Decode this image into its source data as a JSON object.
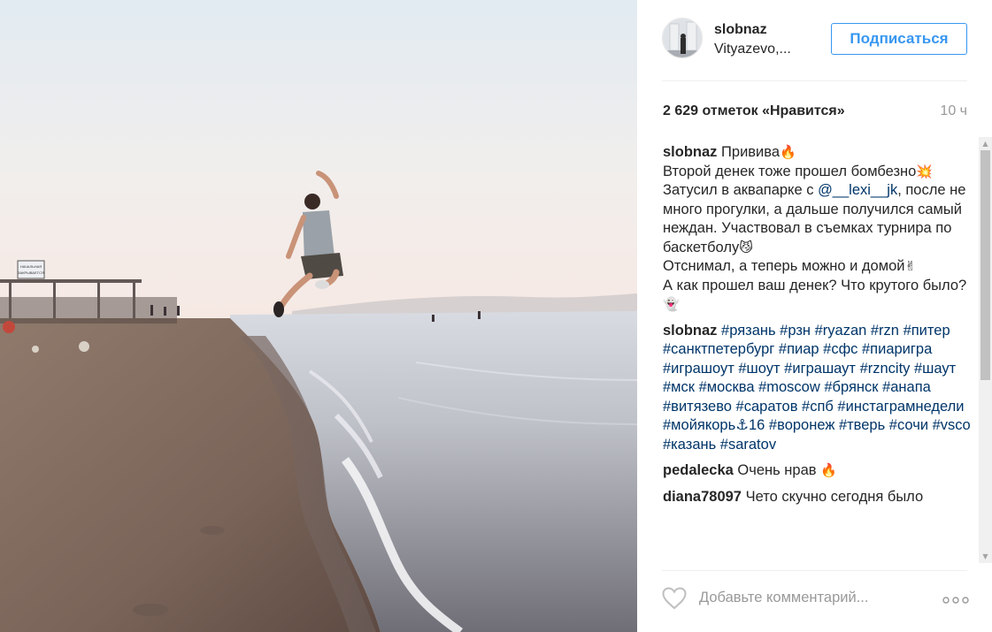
{
  "post": {
    "username": "slobnaz",
    "location": "Vityazevo,...",
    "follow_label": "Подписаться",
    "likes": "2 629 отметок «Нравится»",
    "time": "10 ч"
  },
  "photo": {
    "signboard_text_1": "НАЧАЛЬНАЯ",
    "signboard_text_2": "ЗАКРЫВАЕТСЯ"
  },
  "caption": {
    "user": "slobnaz",
    "line1": "Привива",
    "line2": "Второй денек тоже прошел бомбезно",
    "line3": " Затусил в аквапарке с ",
    "mention": "@__lexi__jk",
    "line4": ", после не много прогулки, а дальше получился самый неждан. Участвовал в съемках турнира по баскетболу",
    "line5": "Отснимал, а теперь можно и домой",
    "line6": "А как прошел ваш денек? Что крутого было?"
  },
  "hashtag_comment": {
    "user": "slobnaz",
    "tags": "#рязань #рзн #ryazan #rzn #питер #санктпетербург #пиар #сфс #пиаригра #играшоут #шоут #играшаут #rzncity #шаут #мск #москва #moscow #брянск #анапа #витязево #саратов #спб #инстаграмнедели #мойякорь⚓16 #воронеж #тверь #сочи #vsco #казань #saratov"
  },
  "comments": [
    {
      "user": "pedalecka",
      "text": "Очень нрав "
    },
    {
      "user": "diana78097",
      "text": "Чето скучно сегодня было"
    }
  ],
  "emoji": {
    "fire": "🔥",
    "boom": "💥",
    "cat": "😼",
    "peace": "✌",
    "ghost": "👻"
  },
  "add_comment_placeholder": "Добавьте комментарий...",
  "icons": {
    "like": "heart-icon",
    "more": "more-options-icon"
  },
  "colors": {
    "link": "#003569",
    "follow": "#3897f0",
    "muted": "#999999"
  }
}
